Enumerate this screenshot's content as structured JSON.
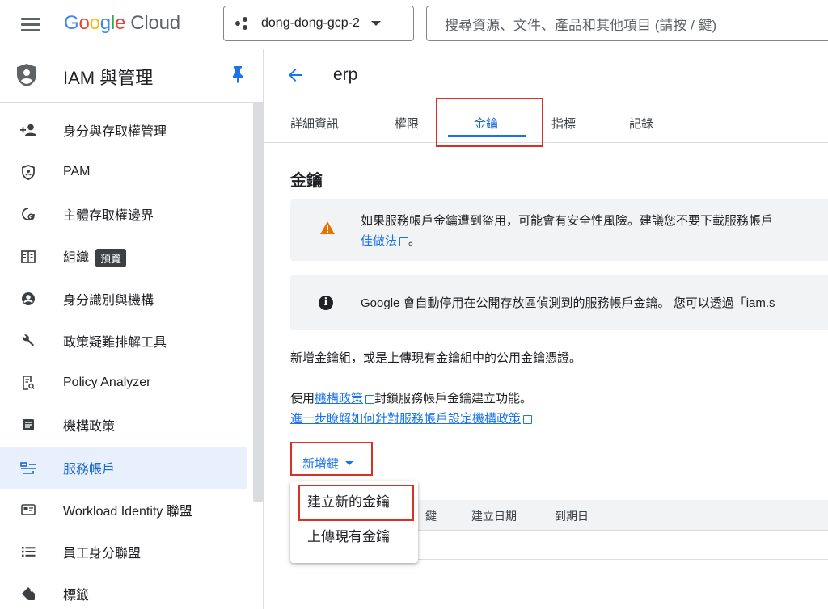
{
  "topbar": {
    "logo_google": [
      "G",
      "o",
      "o",
      "g",
      "l",
      "e"
    ],
    "logo_cloud": "Cloud",
    "project_name": "dong-dong-gcp-2",
    "search_placeholder": "搜尋資源、文件、產品和其他項目 (請按 / 鍵)"
  },
  "sidebar": {
    "title": "IAM 與管理",
    "items": [
      {
        "label": "身分與存取權管理",
        "icon": "person-add-icon"
      },
      {
        "label": "PAM",
        "icon": "shield-badge-icon"
      },
      {
        "label": "主體存取權邊界",
        "icon": "boundary-icon"
      },
      {
        "label": "組織",
        "icon": "organization-icon",
        "badge": "預覽"
      },
      {
        "label": "身分識別與機構",
        "icon": "account-circle-icon"
      },
      {
        "label": "政策疑難排解工具",
        "icon": "wrench-icon"
      },
      {
        "label": "Policy Analyzer",
        "icon": "policy-analyzer-icon"
      },
      {
        "label": "機構政策",
        "icon": "document-icon"
      },
      {
        "label": "服務帳戶",
        "icon": "service-account-icon",
        "active": true
      },
      {
        "label": "Workload Identity 聯盟",
        "icon": "id-card-icon"
      },
      {
        "label": "員工身分聯盟",
        "icon": "list-icon"
      },
      {
        "label": "標籤",
        "icon": "tag-icon"
      }
    ]
  },
  "main": {
    "title": "erp",
    "tabs": [
      {
        "label": "詳細資訊"
      },
      {
        "label": "權限"
      },
      {
        "label": "金鑰",
        "active": true
      },
      {
        "label": "指標"
      },
      {
        "label": "記錄"
      }
    ],
    "section_title": "金鑰",
    "warning": {
      "line1": "如果服務帳戶金鑰遭到盜用，可能會有安全性風險。建議您不要下載服務帳戶",
      "link": "佳做法",
      "tail": "。"
    },
    "info": {
      "text": "Google 會自動停用在公開存放區偵測到的服務帳戶金鑰。 您可以透過「iam.s"
    },
    "para1": "新增金鑰組，或是上傳現有金鑰組中的公用金鑰憑證。",
    "para2": {
      "prefix": "使用",
      "link1": "機構政策",
      "suffix": "封鎖服務帳戶金鑰建立功能。",
      "link2": "進一步瞭解如何針對服務帳戶設定機構政策"
    },
    "add_key_label": "新增鍵",
    "table_headers": [
      "鍵",
      "建立日期",
      "到期日"
    ],
    "menu_items": [
      "建立新的金鑰",
      "上傳現有金鑰"
    ]
  },
  "colors": {
    "accent": "#1a73e8",
    "highlight_box": "#d93025",
    "warning": "#e37400"
  }
}
